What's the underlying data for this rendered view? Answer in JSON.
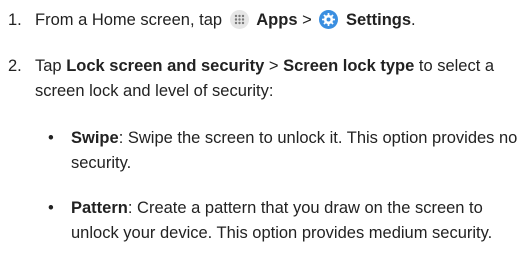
{
  "steps": [
    {
      "number": "1.",
      "text1": "From a Home screen, tap",
      "apps_label": "Apps",
      "separator": ">",
      "settings_label": "Settings",
      "end": "."
    },
    {
      "number": "2.",
      "text1": "Tap",
      "lock_label": "Lock screen and security",
      "separator": ">",
      "screen_lock_label": "Screen lock type",
      "text2": "to select a screen lock and level of security:"
    }
  ],
  "bullets": [
    {
      "marker": "•",
      "title": "Swipe",
      "desc": ": Swipe the screen to unlock it. This option provides no security."
    },
    {
      "marker": "•",
      "title": "Pattern",
      "desc": ": Create a pattern that you draw on the screen to unlock your device. This option provides medium security."
    }
  ],
  "icons": {
    "apps": "apps-grid-icon",
    "settings": "gear-icon"
  },
  "colors": {
    "apps_icon_bg": "#e6e6e6",
    "settings_icon_bg": "#3a8ee0",
    "text": "#222222"
  }
}
